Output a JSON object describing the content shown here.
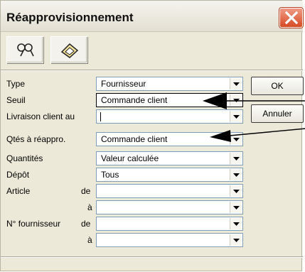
{
  "window": {
    "title": "Réapprovisionnement"
  },
  "toolbar": {
    "buttons": [
      {
        "icon": "search-icon"
      },
      {
        "icon": "eraser-icon"
      }
    ]
  },
  "fields": [
    {
      "label": "Type",
      "value": "Fournisseur"
    },
    {
      "label": "Seuil",
      "value": "Commande client"
    },
    {
      "label": "Livraison client au",
      "value": ""
    },
    {
      "label": "Qtés à réappro.",
      "value": "Commande client"
    },
    {
      "label": "Quantités",
      "value": "Valeur calculée"
    },
    {
      "label": "Dépôt",
      "value": "Tous"
    },
    {
      "label": "Article",
      "sub": "de",
      "value": ""
    },
    {
      "label": "",
      "sub": "à",
      "value": ""
    },
    {
      "label": "N° fournisseur",
      "sub": "de",
      "value": ""
    },
    {
      "label": "",
      "sub": "à",
      "value": ""
    }
  ],
  "buttons": {
    "ok": "OK",
    "cancel": "Annuler"
  },
  "colors": {
    "close_button": "#d74a22",
    "input_border": "#7f9db9",
    "window_bg": "#ece9d8"
  }
}
